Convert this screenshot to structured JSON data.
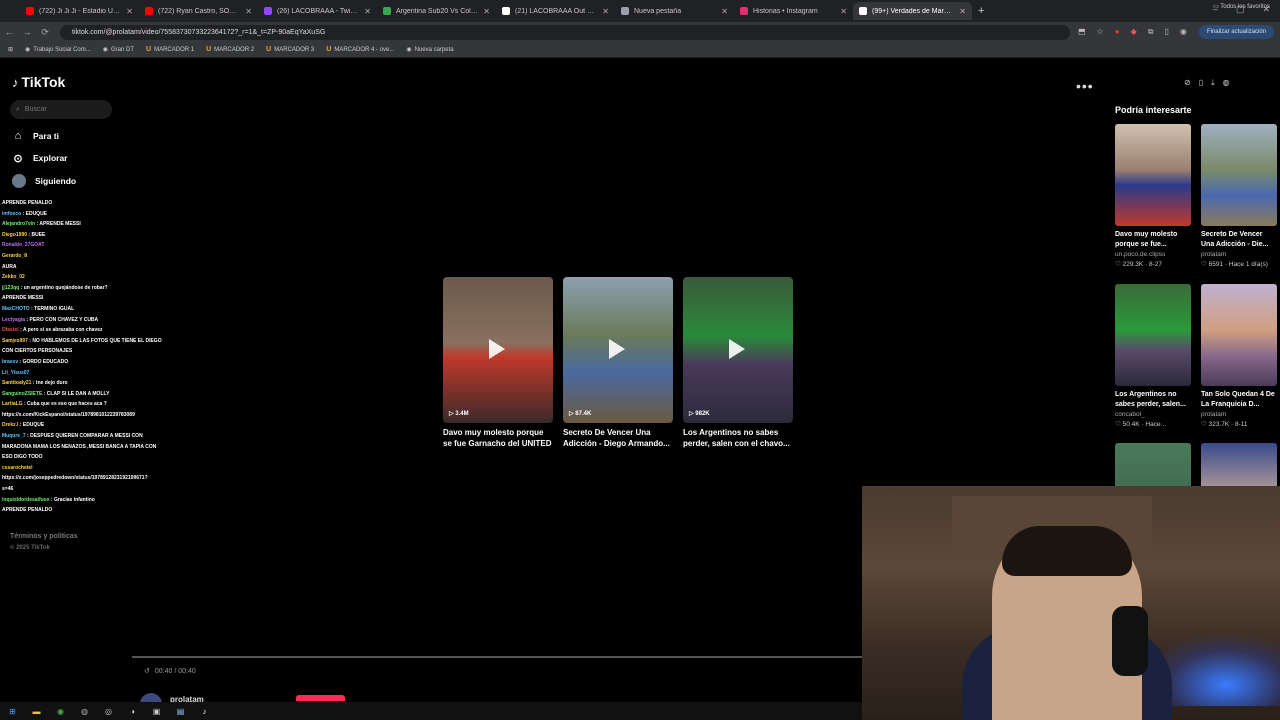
{
  "browser": {
    "tabs": [
      {
        "title": "(722) Ji Ji Ji - Estadio Único de",
        "color": "#ff0000",
        "active": false
      },
      {
        "title": "(722) Ryan Castro, SOG, Selecta",
        "color": "#ff0000",
        "active": false
      },
      {
        "title": "(26) LACOBRAAA - Twitch",
        "color": "#9146ff",
        "active": false
      },
      {
        "title": "Argentina Sub20 Vs Colombia",
        "color": "#34a853",
        "active": false
      },
      {
        "title": "(21) LACOBRAAA Out of Conte",
        "color": "#ffffff",
        "active": false
      },
      {
        "title": "Nueva pestaña",
        "color": "#9aa0a6",
        "active": false
      },
      {
        "title": "Historias • Instagram",
        "color": "#e1306c",
        "active": false
      },
      {
        "title": "(99+) Verdades de Maradona a",
        "color": "#ffffff",
        "active": true
      }
    ],
    "url": "tiktok.com/@prolatam/video/7558373073322364172?_r=1&_t=ZP-90aEqYaXuSG",
    "update_label": "Finalizar actualización",
    "bookmarks": [
      {
        "label": "Trabajo Social Com...",
        "u": false
      },
      {
        "label": "Gran DT",
        "u": false
      },
      {
        "label": "MARCADOR 1",
        "u": true
      },
      {
        "label": "MARCADOR 2",
        "u": true
      },
      {
        "label": "MARCADOR 3",
        "u": true
      },
      {
        "label": "MARCADOR 4 - ove...",
        "u": true
      },
      {
        "label": "Nueva carpeta",
        "u": false
      }
    ],
    "all_bookmarks": "Todos los favoritos"
  },
  "sidebar": {
    "logo": "TikTok",
    "search_placeholder": "Buscar",
    "nav": [
      {
        "label": "Para ti",
        "icon": "home-icon"
      },
      {
        "label": "Explorar",
        "icon": "compass-icon"
      },
      {
        "label": "Siguiendo",
        "icon": "avatar"
      }
    ],
    "footer_terms": "Términos y políticas",
    "footer_copy": "© 2025 TikTok"
  },
  "chat": [
    {
      "user": "",
      "msg": "APRENDE PENALDO",
      "c": "u1"
    },
    {
      "user": "imfosco",
      "msg": "EDUQUE",
      "c": "u2"
    },
    {
      "user": "",
      "msg": "",
      "c": "u1"
    },
    {
      "user": "Alejandro7vin",
      "msg": "APRENDE MESSI",
      "c": "u3"
    },
    {
      "user": "Diego1990",
      "msg": "BUEE",
      "c": "u5"
    },
    {
      "user": "Ronaldo_27GOAT",
      "msg": "",
      "c": "u4"
    },
    {
      "user": "Gerardo_8",
      "msg": "",
      "c": "u5"
    },
    {
      "user": "",
      "msg": "AURA",
      "c": "u1"
    },
    {
      "user": "Zekko_02",
      "msg": "",
      "c": "u5"
    },
    {
      "user": "jj123qq",
      "msg": "un argentino quejándose de robar?",
      "c": "u3"
    },
    {
      "user": "",
      "msg": "APRENDE MESSI",
      "c": "u1"
    },
    {
      "user": "MaxCHOTO",
      "msg": "TERMINO IGUAL",
      "c": "u2"
    },
    {
      "user": "Lectyagia",
      "msg": "PERO CON CHAVEZ Y CUBA",
      "c": "u4"
    },
    {
      "user": "Dfastel",
      "msg": "A pero si se abrazaba con chavez",
      "c": "u1"
    },
    {
      "user": "Samjes997",
      "msg": "NO HABLEMOS DE LAS FOTOS QUE TIENE EL DIEGO",
      "c": "u5"
    },
    {
      "user": "",
      "msg": "CON CIERTOS PERSONAJES",
      "c": "u5"
    },
    {
      "user": "brassv",
      "msg": "GORDO EDUCADO",
      "c": "u2"
    },
    {
      "user": "",
      "msg": "",
      "c": "u5"
    },
    {
      "user": "Lil_Yisus07",
      "msg": "",
      "c": "u2"
    },
    {
      "user": "Santitoaly21",
      "msg": "tne dejo duro",
      "c": "u5"
    },
    {
      "user": "SanguinoZSIETE",
      "msg": "CLAP SI LE DAN A MOLLY",
      "c": "u3"
    },
    {
      "user": "LartiaLG",
      "msg": "Cuba que es eso que haces aca ?",
      "c": "u5"
    },
    {
      "user": "",
      "msg": "https://x.com/KickEspanol/status/1978981012239783089",
      "c": "u5"
    },
    {
      "user": "Drekz.l",
      "msg": "EDUQUE",
      "c": "u5"
    },
    {
      "user": "Muqure_7",
      "msg": "DESPUES QUIEREN COMPARAR A MESSI CON",
      "c": "u2"
    },
    {
      "user": "",
      "msg": "MARADONA MAMA LOS NENAZOS ,MESSI BANCA A TAPIA CON",
      "c": "u5"
    },
    {
      "user": "",
      "msg": "ESO DIGO TODO",
      "c": "u5"
    },
    {
      "user": "cssarochetel",
      "msg": "",
      "c": "u5"
    },
    {
      "user": "",
      "msg": "https://x.com/joseppedredown/status/1978912823192199671?",
      "c": "u5"
    },
    {
      "user": "",
      "msg": "s=46",
      "c": "u5"
    },
    {
      "user": "inquisidordesalfuox",
      "msg": "Gracias infantino",
      "c": "u3"
    },
    {
      "user": "",
      "msg": "APRENDE PENALDO",
      "c": "u1"
    }
  ],
  "related": [
    {
      "title": "Davo muy molesto porque se fue Garnacho del UNITED ...",
      "views": "3.4M",
      "bg": "linear-gradient(180deg,#6a5a4a 0%,#8a7060 45%,#c0392b 55%,#3a2a2a 100%)"
    },
    {
      "title": "Secreto De Vencer Una Adicción - Diego Armando...",
      "views": "87.4K",
      "bg": "linear-gradient(180deg,#8ca0b0 0%,#6a7a5a 40%,#4a6aa0 65%,#6a5a40 100%)"
    },
    {
      "title": "Los Argentinos no sabes perder, salen con el chavo...",
      "views": "982K",
      "bg": "linear-gradient(180deg,#3a5a3a 0%,#2a8a3a 40%,#4a3a5a 60%,#2a2a3a 100%)"
    }
  ],
  "right_panel": {
    "title": "Podría interesarte",
    "items": [
      {
        "title": "Davo muy molesto porque se fue...",
        "author": "un.poco.de.clipss",
        "meta": "229.3K · 8-27",
        "bg": "linear-gradient(180deg,#d0c0b0 0%,#9a8070 45%,#2a3a8a 60%,#c0392b 100%)"
      },
      {
        "title": "Secreto De Vencer Una Adicción - Die...",
        "author": "prolatam",
        "meta": "6591 · Hace 1 día(s)",
        "bg": "linear-gradient(180deg,#a0b0c0 0%,#7a8a6a 45%,#4a6ab0 70%,#8a7a5a 100%)"
      },
      {
        "title": "Los Argentinos no sabes perder, salen...",
        "author": "concabol_",
        "meta": "50.4K · Hace...",
        "bg": "linear-gradient(180deg,#3a6a3a 0%,#2a9a3a 45%,#5a4a6a 65%,#2a2a3a 100%)"
      },
      {
        "title": "Tan Solo Quedan 4 De La Franquicia D...",
        "author": "prolatam",
        "meta": "323.7K · 8-11",
        "bg": "linear-gradient(180deg,#c0b0d0 0%,#d0a080 45%,#8a6a8a 70%,#4a3a5a 100%)"
      },
      {
        "title": "",
        "author": "",
        "meta": "",
        "bg": "linear-gradient(180deg,#4a7a5a 0%,#3a5a4a 100%)"
      },
      {
        "title": "",
        "author": "",
        "meta": "",
        "bg": "linear-gradient(180deg,#3a4a8a 0%,#d0b0a0 60%,#e0e0e0 100%)"
      }
    ]
  },
  "player": {
    "time": "00:40 / 00:40",
    "author": "prolatam"
  }
}
